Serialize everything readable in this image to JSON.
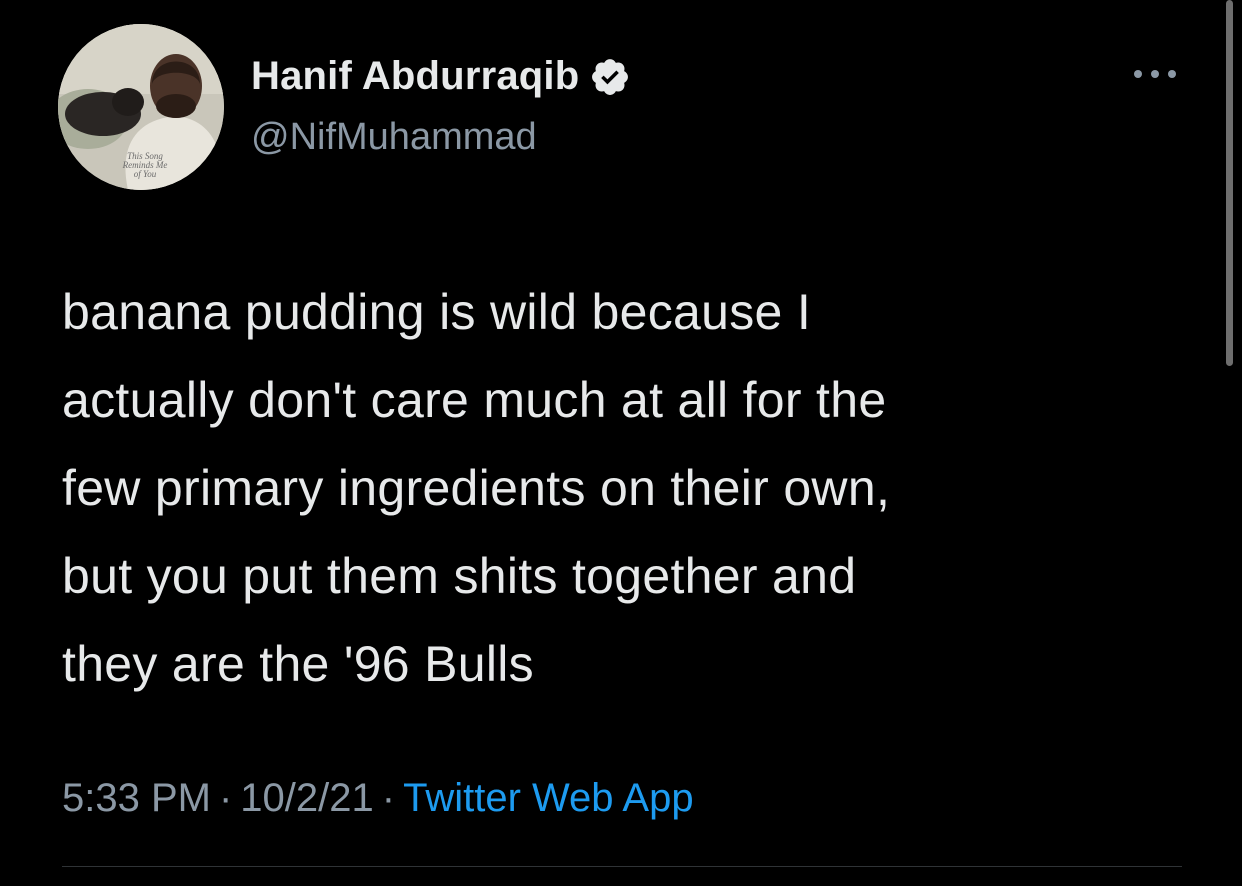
{
  "tweet": {
    "author": {
      "display_name": "Hanif Abdurraqib",
      "handle": "@NifMuhammad",
      "verified": true,
      "avatar_shirt_text": "This Song Reminds Me of You"
    },
    "text": "banana pudding is wild because I\nactually don't care much at all for the\nfew primary ingredients on their own,\nbut you put them shits together and\nthey are the '96 Bulls",
    "time": "5:33 PM",
    "separator": "·",
    "date": "10/2/21",
    "source": "Twitter Web App"
  },
  "icons": {
    "verified": "verified-badge-icon",
    "more": "more-options-icon"
  },
  "colors": {
    "background": "#000000",
    "primary_text": "#e7e9ea",
    "secondary_text": "#8b98a5",
    "link": "#1d9bf0"
  }
}
